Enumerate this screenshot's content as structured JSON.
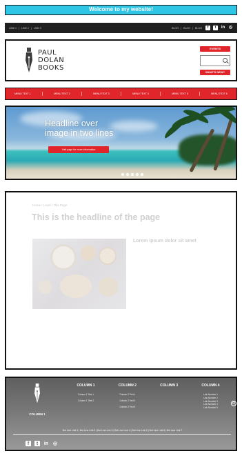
{
  "welcome": "Welcome to my website!",
  "topbar": {
    "links": [
      "LINK 1",
      "|",
      "LINK 2",
      "|",
      "LINK 3"
    ],
    "right_links": [
      "BLOG",
      "|",
      "BLOG",
      "|",
      "BLOG"
    ],
    "social": {
      "facebook": "f",
      "twitter": "t",
      "linkedin": "in",
      "instagram": "◎"
    }
  },
  "header": {
    "logo_lines": [
      "PAUL",
      "DOLAN",
      "BOOKS"
    ],
    "events_button": "EVENTS",
    "news_button": "WHAT'S NEW?"
  },
  "menu": [
    "MENU TEXT 1",
    "MENU TEXT 2",
    "MENU TEXT 3",
    "MENU TEXT 4",
    "MENU TEXT 5",
    "MENU TEXT 6"
  ],
  "hero": {
    "headline_line1": "Headline over",
    "headline_line2": "image in two lines",
    "button": "Visit page for more information",
    "slides": 5,
    "active_slide": 1
  },
  "content": {
    "breadcrumb": "Home  /  Level  /  This Page",
    "title": "This is the headline of the page",
    "meta_left": "",
    "meta_right": "",
    "caption": "",
    "article_title": "Lorem ipsum dolor sit amet",
    "paragraph1": "",
    "paragraph2": ""
  },
  "footer": {
    "left_title": "COLUMN 1",
    "left_text": "",
    "columns": [
      {
        "title": "COLUMN 1",
        "items": [
          "Column 1 Text 1",
          "Column 1 Text 2"
        ]
      },
      {
        "title": "COLUMN 2",
        "items": [
          "Column 2 Text 1",
          "Column 2 Text 2",
          "Column 2 Text 3"
        ]
      },
      {
        "title": "COLUMN 3",
        "items": [
          "",
          ""
        ]
      },
      {
        "title": "COLUMN 4",
        "items": [
          "Link Number 1",
          "Link Number 2",
          "Link Number 3",
          "Link Number 4",
          "Link Number 5"
        ]
      }
    ],
    "bottom_links": "Bot Line Link 1 | Bot Line Link 2 | Bot Line Link 3 | Bot Line Link 4 | Bot Line Link 5 | Bot Line Link 6 | Bot Line Link 7",
    "copyright": "",
    "social": {
      "facebook": "f",
      "twitter": "t",
      "linkedin": "in",
      "instagram": "◎"
    }
  },
  "colors": {
    "accent_red": "#e0262b",
    "welcome_cyan": "#2fc6e6",
    "dark": "#1f1f1f"
  }
}
